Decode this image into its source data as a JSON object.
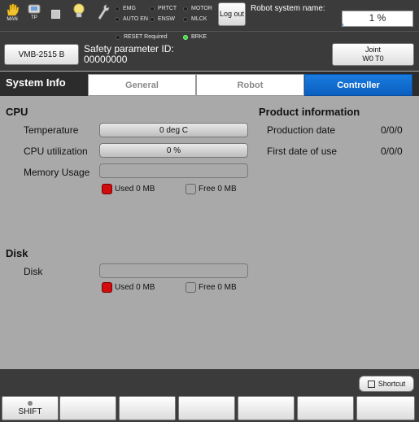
{
  "topbar": {
    "mode_icons": [
      {
        "label": "MAN",
        "icon": "hand-icon"
      },
      {
        "label": "TP",
        "icon": "teach-pendant-icon"
      }
    ],
    "indicators": [
      {
        "label": "EMG",
        "on": false
      },
      {
        "label": "PRTCT",
        "on": false
      },
      {
        "label": "MOTOR",
        "on": false
      },
      {
        "label": "AUTO EN",
        "on": false
      },
      {
        "label": "ENSW",
        "on": false
      },
      {
        "label": "MLCK",
        "on": false
      }
    ],
    "logout_label": "Log out",
    "robot_system_name_label": "Robot system name:",
    "progress": {
      "text": "1 %",
      "value": 1
    }
  },
  "bar2": {
    "indicators": [
      {
        "label": "RESET Required",
        "on": false
      },
      {
        "label": "BRKE",
        "on": true
      }
    ],
    "model_button": "VMB-2515 B",
    "safety_parameter_label": "Safety parameter ID:",
    "safety_parameter_id": "00000000",
    "joint_button": {
      "line1": "Joint",
      "line2": "W0 T0"
    }
  },
  "tabbar": {
    "title": "System Info",
    "tabs": [
      {
        "label": "General",
        "active": false
      },
      {
        "label": "Robot",
        "active": false
      },
      {
        "label": "Controller",
        "active": true
      }
    ]
  },
  "cpu": {
    "heading": "CPU",
    "temperature_label": "Temperature",
    "temperature_value": "0 deg C",
    "utilization_label": "CPU utilization",
    "utilization_value": "0 %",
    "memory_label": "Memory Usage",
    "memory_used": "Used 0 MB",
    "memory_free": "Free 0 MB"
  },
  "disk": {
    "heading": "Disk",
    "disk_label": "Disk",
    "used": "Used 0 MB",
    "free": "Free 0 MB"
  },
  "product": {
    "heading": "Product information",
    "production_date_label": "Production date",
    "production_date": "0/0/0",
    "first_use_label": "First date of use",
    "first_use": "0/0/0"
  },
  "bottom": {
    "shortcut_label": "Shortcut",
    "function_keys": [
      "SHIFT",
      "",
      "",
      "",
      "",
      "",
      "",
      ""
    ]
  },
  "colors": {
    "active_tab": "#0a6bd1",
    "used_swatch": "#d10c0c",
    "brke_indicator": "#39d43a"
  }
}
